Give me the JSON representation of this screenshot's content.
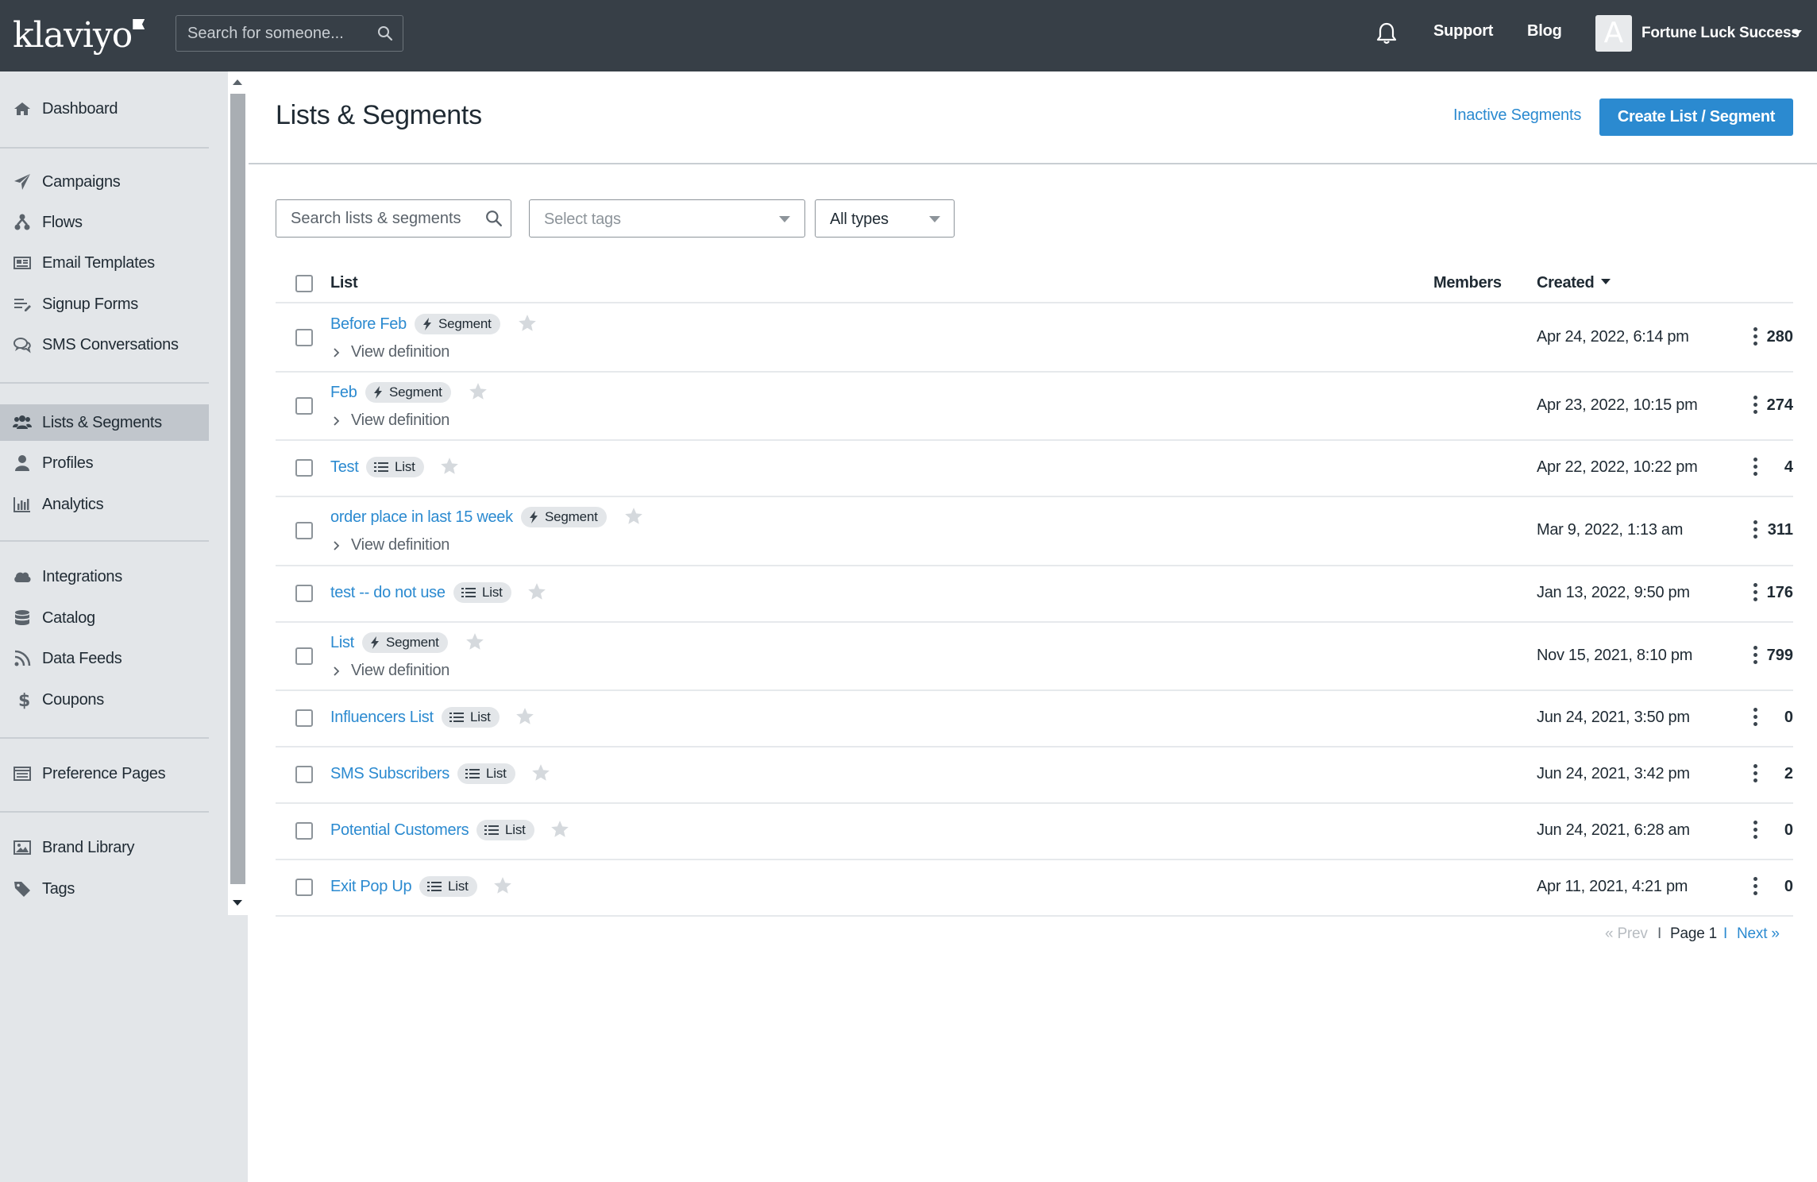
{
  "topbar": {
    "logo": "klaviyo",
    "search_placeholder": "Search for someone...",
    "support": "Support",
    "blog": "Blog",
    "avatar_initial": "A",
    "account_name": "Fortune Luck Success"
  },
  "sidebar": {
    "items": [
      {
        "label": "Dashboard",
        "icon": "home-icon"
      },
      {
        "label": "Campaigns",
        "icon": "paper-plane-icon"
      },
      {
        "label": "Flows",
        "icon": "flows-icon"
      },
      {
        "label": "Email Templates",
        "icon": "newspaper-icon"
      },
      {
        "label": "Signup Forms",
        "icon": "form-list-icon"
      },
      {
        "label": "SMS Conversations",
        "icon": "chat-icon"
      },
      {
        "label": "Lists & Segments",
        "icon": "users-icon"
      },
      {
        "label": "Profiles",
        "icon": "user-icon"
      },
      {
        "label": "Analytics",
        "icon": "bar-chart-icon"
      },
      {
        "label": "Integrations",
        "icon": "cloud-icon"
      },
      {
        "label": "Catalog",
        "icon": "database-icon"
      },
      {
        "label": "Data Feeds",
        "icon": "rss-icon"
      },
      {
        "label": "Coupons",
        "icon": "dollar-icon"
      },
      {
        "label": "Preference Pages",
        "icon": "window-list-icon"
      },
      {
        "label": "Brand Library",
        "icon": "image-icon"
      },
      {
        "label": "Tags",
        "icon": "tag-icon"
      }
    ],
    "active": "Lists & Segments"
  },
  "main": {
    "title": "Lists & Segments",
    "inactive_link": "Inactive Segments",
    "create_button": "Create List / Segment",
    "filters": {
      "search_placeholder": "Search lists & segments",
      "tags_placeholder": "Select tags",
      "type_selected": "All types"
    },
    "columns": {
      "list": "List",
      "members": "Members",
      "created": "Created"
    },
    "view_definition": "View definition",
    "rows": [
      {
        "name": "Before Feb",
        "type": "Segment",
        "members": "280",
        "created": "Apr 24, 2022, 6:14 pm"
      },
      {
        "name": "Feb",
        "type": "Segment",
        "members": "274",
        "created": "Apr 23, 2022, 10:15 pm"
      },
      {
        "name": "Test",
        "type": "List",
        "members": "4",
        "created": "Apr 22, 2022, 10:22 pm"
      },
      {
        "name": "order place in last 15 week",
        "type": "Segment",
        "members": "311",
        "created": "Mar 9, 2022, 1:13 am"
      },
      {
        "name": "test -- do not use",
        "type": "List",
        "members": "176",
        "created": "Jan 13, 2022, 9:50 pm"
      },
      {
        "name": "List",
        "type": "Segment",
        "members": "799",
        "created": "Nov 15, 2021, 8:10 pm"
      },
      {
        "name": "Influencers List",
        "type": "List",
        "members": "0",
        "created": "Jun 24, 2021, 3:50 pm"
      },
      {
        "name": "SMS Subscribers",
        "type": "List",
        "members": "2",
        "created": "Jun 24, 2021, 3:42 pm"
      },
      {
        "name": "Potential Customers",
        "type": "List",
        "members": "0",
        "created": "Jun 24, 2021, 6:28 am"
      },
      {
        "name": "Exit Pop Up",
        "type": "List",
        "members": "0",
        "created": "Apr 11, 2021, 4:21 pm"
      }
    ],
    "pagination": {
      "prev": "« Prev",
      "separator": "I",
      "page": "Page 1",
      "next": "Next »"
    }
  },
  "colors": {
    "topbar": "#373f47",
    "sidebar": "#e3e6e9",
    "accent": "#2b8ad0",
    "text": "#1f2a33"
  }
}
